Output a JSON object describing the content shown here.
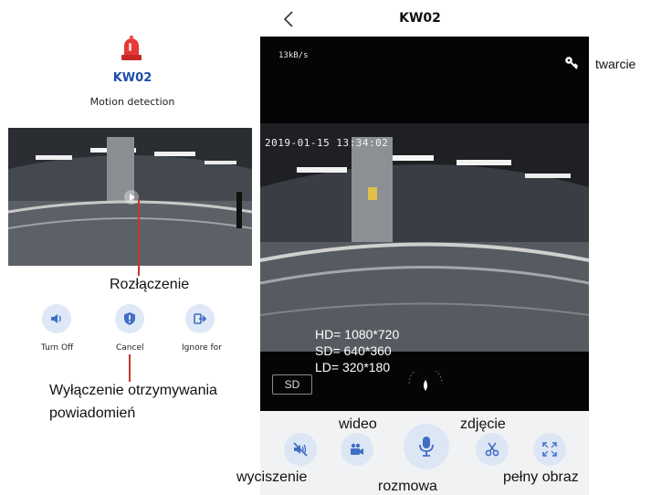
{
  "left": {
    "title": "KW02",
    "subtitle": "Motion detection",
    "buttons": [
      {
        "label": "Turn Off",
        "icon": "speaker-icon"
      },
      {
        "label": "Cancel",
        "icon": "shield-icon"
      },
      {
        "label": "Ignore for",
        "icon": "exit-icon"
      }
    ],
    "annotations": {
      "disconnect": "Rozłączenie",
      "disable_line1": "Wyłączenie otrzymywania",
      "disable_line2": "powiadomień"
    }
  },
  "right": {
    "title": "KW02",
    "speed": "13kB/s",
    "timestamp": "2019-01-15  13:34:02",
    "key_label": "twarcie",
    "resolutions": [
      "HD= 1080*720",
      "SD= 640*360",
      "LD= 320*180"
    ],
    "quality_button": "SD",
    "controls": {
      "mute": "wyciszenie",
      "video": "wideo",
      "talk": "rozmowa",
      "snapshot": "zdjęcie",
      "fullscreen": "pełny obraz"
    }
  },
  "colors": {
    "accent": "#1f4ea8",
    "button_bg": "#dde6f5",
    "alarm_red": "#e53935",
    "callout": "#c0392b"
  }
}
